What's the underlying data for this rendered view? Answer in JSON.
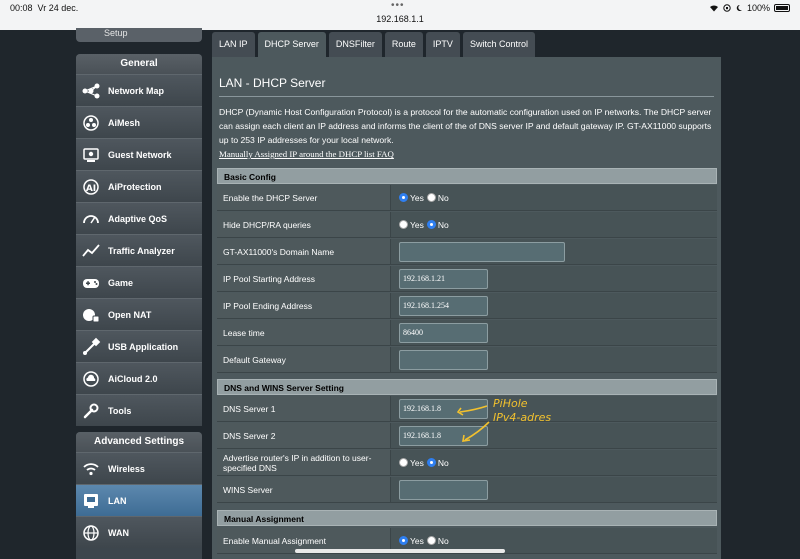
{
  "status_bar": {
    "time": "00:08",
    "date": "Vr 24 dec.",
    "url": "192.168.1.1",
    "battery": "100%"
  },
  "sidebar": {
    "top_partial_label": "Setup",
    "general_header": "General",
    "general_items": [
      {
        "label": "Network Map",
        "icon": "network-map-icon"
      },
      {
        "label": "AiMesh",
        "icon": "aimesh-icon"
      },
      {
        "label": "Guest Network",
        "icon": "guest-network-icon"
      },
      {
        "label": "AiProtection",
        "icon": "aiprotection-icon"
      },
      {
        "label": "Adaptive QoS",
        "icon": "qos-gauge-icon"
      },
      {
        "label": "Traffic Analyzer",
        "icon": "traffic-analyzer-icon"
      },
      {
        "label": "Game",
        "icon": "gamepad-icon"
      },
      {
        "label": "Open NAT",
        "icon": "open-nat-icon"
      },
      {
        "label": "USB Application",
        "icon": "usb-icon"
      },
      {
        "label": "AiCloud 2.0",
        "icon": "cloud-icon"
      },
      {
        "label": "Tools",
        "icon": "wrench-icon"
      }
    ],
    "advanced_header": "Advanced Settings",
    "advanced_items": [
      {
        "label": "Wireless",
        "icon": "wifi-icon"
      },
      {
        "label": "LAN",
        "icon": "lan-icon",
        "active": true
      },
      {
        "label": "WAN",
        "icon": "globe-icon"
      }
    ]
  },
  "tabs": [
    "LAN IP",
    "DHCP Server",
    "DNSFilter",
    "Route",
    "IPTV",
    "Switch Control"
  ],
  "active_tab": "DHCP Server",
  "page": {
    "title": "LAN - DHCP Server",
    "description": "DHCP (Dynamic Host Configuration Protocol) is a protocol for the automatic configuration used on IP networks. The DHCP server can assign each client an IP address and informs the client of the of DNS server IP and default gateway IP. GT-AX11000 supports up to 253 IP addresses for your local network.",
    "faq_link": "Manually Assigned IP around the DHCP list FAQ"
  },
  "basic_config": {
    "header": "Basic Config",
    "enable_dhcp": {
      "label": "Enable the DHCP Server",
      "yes": "Yes",
      "no": "No",
      "value": "Yes"
    },
    "hide_dhcp": {
      "label": "Hide DHCP/RA queries",
      "yes": "Yes",
      "no": "No",
      "value": "No"
    },
    "domain_name": {
      "label": "GT-AX11000's Domain Name",
      "value": ""
    },
    "pool_start": {
      "label": "IP Pool Starting Address",
      "value": "192.168.1.21"
    },
    "pool_end": {
      "label": "IP Pool Ending Address",
      "value": "192.168.1.254"
    },
    "lease_time": {
      "label": "Lease time",
      "value": "86400"
    },
    "default_gateway": {
      "label": "Default Gateway",
      "value": ""
    }
  },
  "dns_wins": {
    "header": "DNS and WINS Server Setting",
    "dns1": {
      "label": "DNS Server 1",
      "value": "192.168.1.8"
    },
    "dns2": {
      "label": "DNS Server 2",
      "value": "192.168.1.8"
    },
    "advertise": {
      "label": "Advertise router's IP in addition to user-specified DNS",
      "yes": "Yes",
      "no": "No",
      "value": "No"
    },
    "wins": {
      "label": "WINS Server",
      "value": ""
    }
  },
  "manual_assignment": {
    "header": "Manual Assignment",
    "enable": {
      "label": "Enable Manual Assignment",
      "yes": "Yes",
      "no": "No",
      "value": "Yes"
    }
  },
  "annotation": {
    "line1": "PiHole",
    "line2": "IPv4-adres",
    "color": "#f2c12e"
  }
}
